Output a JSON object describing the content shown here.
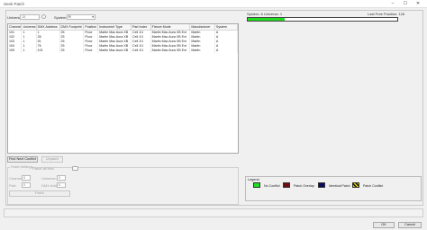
{
  "window": {
    "title": "Seek Patch",
    "minimize": "–",
    "maximize": "☐",
    "close": "✕"
  },
  "filters": {
    "universe_label": "Universe:",
    "universe_value": "15",
    "system_label": "System:",
    "system_value": "R"
  },
  "table": {
    "columns": [
      "Channel",
      "Universe",
      "DMX Address",
      "DMX Footprint",
      "Position",
      "Instrument Type",
      "Part Index",
      "Fixture Mode",
      "Manufacturer",
      "System"
    ],
    "rows": [
      [
        "101",
        "1",
        "1",
        "25",
        "Floor",
        "Martin Mac Aura XB",
        "Cell 1/1",
        "Martin Mac Aura XB Ext",
        "Martin",
        "A"
      ],
      [
        "102",
        "1",
        "26",
        "25",
        "Floor",
        "Martin Mac Aura XB",
        "Cell 1/1",
        "Martin Mac Aura XB Ext",
        "Martin",
        "A"
      ],
      [
        "103",
        "1",
        "51",
        "25",
        "Floor",
        "Martin Mac Aura XB",
        "Cell 1/1",
        "Martin Mac Aura XB Ext",
        "Martin",
        "A"
      ],
      [
        "104",
        "1",
        "76",
        "25",
        "Floor",
        "Martin Mac Aura XB",
        "Cell 1/1",
        "Martin Mac Aura XB Ext",
        "Martin",
        "A"
      ],
      [
        "105",
        "1",
        "101",
        "25",
        "Floor",
        "Martin Mac Aura XB",
        "Cell 1/1",
        "Martin Mac Aura XB Ext",
        "Martin",
        "A"
      ]
    ]
  },
  "buttons": {
    "find_next_conflict": "Find Next Conflict",
    "unpatch": "Unpatch",
    "patch": "Patch",
    "ok": "OK",
    "cancel": "Cancel"
  },
  "patch_settings": {
    "group_title": "Patch Settings",
    "patch_all_label": "Patch all fixtu",
    "channel_label": "Channel:",
    "channel_value": "0",
    "universe_label": "Universe:",
    "universe_value": "0",
    "part_label": "Part:",
    "part_value": "0",
    "dmx_address_label": "DMX Address:",
    "dmx_address_value": "0"
  },
  "universe_view": {
    "header": "System: A  Universe: 1",
    "last_free": "Last Free Position: 126",
    "used_fraction": 0.245
  },
  "legend": {
    "title": "Legend",
    "items": [
      {
        "label": "No Conflict",
        "color": "#22dd22",
        "pattern": "solid"
      },
      {
        "label": "Patch Overlap",
        "color": "#6b0f0f",
        "pattern": "solid"
      },
      {
        "label": "Identical Patch",
        "color": "#0a0a5e",
        "pattern": "solid"
      },
      {
        "label": "Patch Conflict",
        "color": "#e8d800",
        "pattern": "stripes"
      }
    ]
  }
}
